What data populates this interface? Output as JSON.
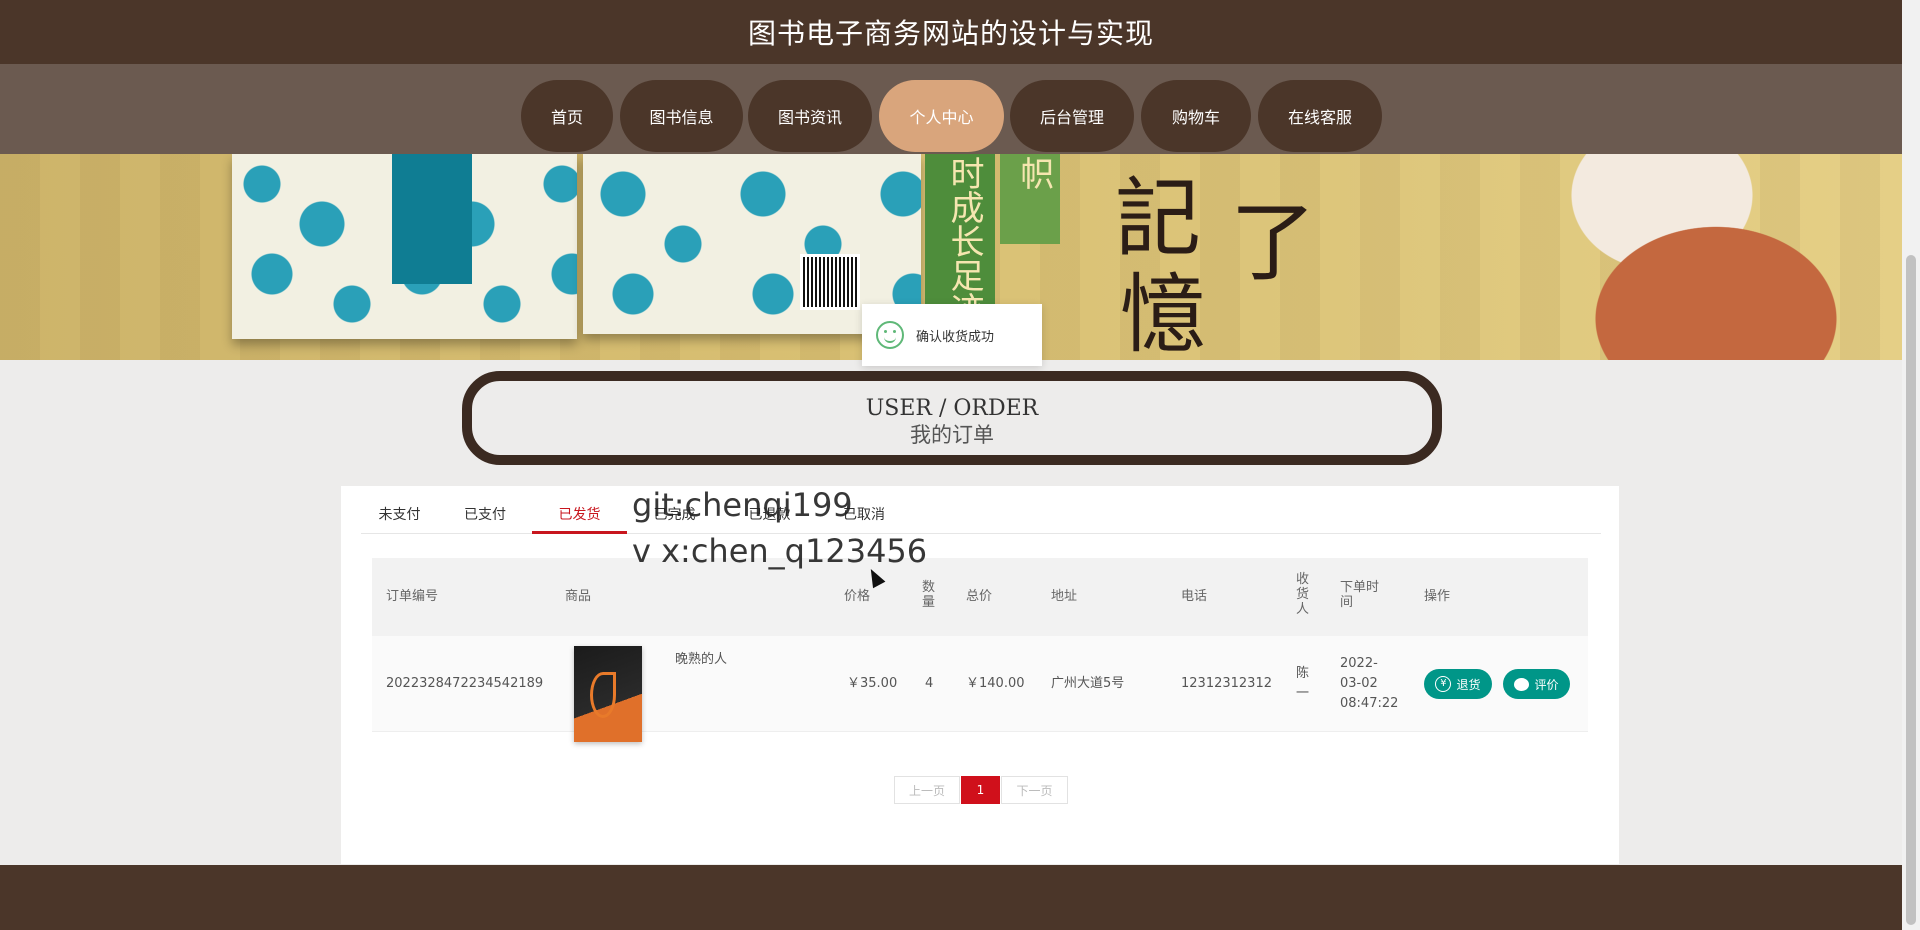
{
  "header": {
    "title": "图书电子商务网站的设计与实现"
  },
  "nav": {
    "items": [
      {
        "label": "首页"
      },
      {
        "label": "图书信息"
      },
      {
        "label": "图书资讯"
      },
      {
        "label": "个人中心",
        "active": true
      },
      {
        "label": "后台管理"
      },
      {
        "label": "购物车"
      },
      {
        "label": "在线客服"
      }
    ]
  },
  "banner": {
    "text_1": "时成长足迹",
    "text_2": "帜",
    "text_3": "記",
    "text_4": "了",
    "text_5": "憶"
  },
  "toast": {
    "message": "确认收货成功"
  },
  "section": {
    "title_en": "USER / ORDER",
    "title_cn": "我的订单"
  },
  "tabs": [
    {
      "label": "未支付"
    },
    {
      "label": "已支付"
    },
    {
      "label": "已发货",
      "active": true
    },
    {
      "label": "已完成"
    },
    {
      "label": "已退款"
    },
    {
      "label": "已取消"
    }
  ],
  "watermark": {
    "line1": "git:chenqi199",
    "line2": "v x:chen_q123456"
  },
  "table": {
    "headers": {
      "order_no": "订单编号",
      "product": "商品",
      "price": "价格",
      "quantity": "数\n量",
      "total": "总价",
      "address": "地址",
      "phone": "电话",
      "receiver": "收\n货\n人",
      "order_time": "下单时\n间",
      "actions": "操作"
    },
    "rows": [
      {
        "order_no": "2022328472234542189",
        "product_name": "晚熟的人",
        "price": "￥35.00",
        "quantity": "4",
        "total": "￥140.00",
        "address": "广州大道5号",
        "phone": "12312312312",
        "receiver": "陈\n一",
        "order_time": "2022-\n03-02\n08:47:22",
        "refund_label": "退货",
        "review_label": "评价"
      }
    ]
  },
  "pagination": {
    "prev": "上一页",
    "current": "1",
    "next": "下一页"
  },
  "colors": {
    "brown": "#4b3629",
    "nav_bg": "#6b5a50",
    "active_nav": "#d9a57c",
    "accent_red": "#c8161e",
    "teal": "#009688"
  }
}
